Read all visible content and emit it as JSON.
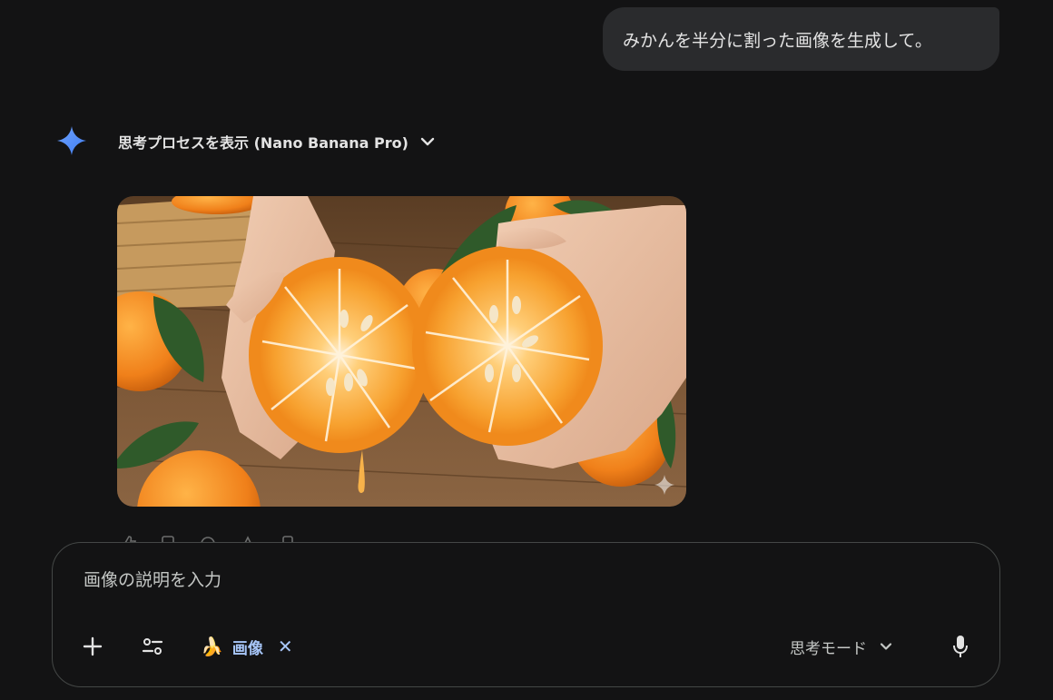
{
  "conversation": {
    "user_message": "みかんを半分に割った画像を生成して。",
    "response": {
      "thinking_label": "思考プロセスを表示 (Nano Banana Pro)",
      "image_icon": "generated-image-oranges",
      "watermark_icon": "sparkle-icon"
    }
  },
  "composer": {
    "placeholder": "画像の説明を入力",
    "value": "",
    "add_icon": "plus-icon",
    "tools_icon": "tune-icon",
    "chip": {
      "emoji": "🍌",
      "label": "画像",
      "close": "✕"
    },
    "mode": {
      "label": "思考モード"
    },
    "mic_icon": "mic-icon"
  },
  "colors": {
    "background": "#131314",
    "bubble": "#2a2b2d",
    "chip_text": "#a8c7fa",
    "gemini_blue": "#4a8af4"
  }
}
